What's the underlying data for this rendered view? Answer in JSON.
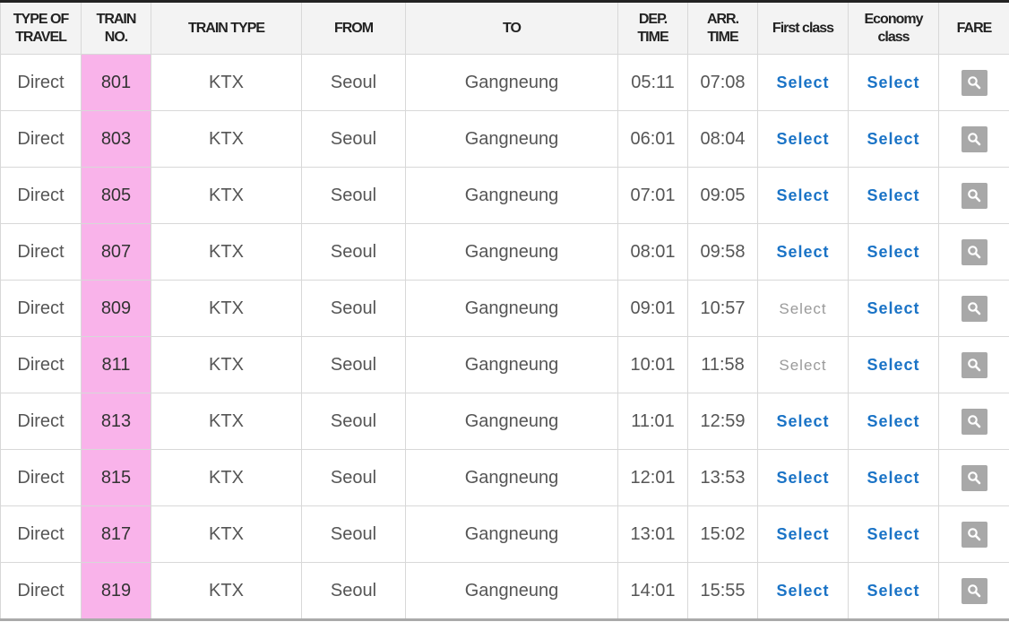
{
  "header": {
    "type_of_travel": "TYPE OF TRAVEL",
    "train_no": "TRAIN NO.",
    "train_type": "TRAIN TYPE",
    "from": "FROM",
    "to": "TO",
    "dep_time": "DEP. TIME",
    "arr_time": "ARR. TIME",
    "first_class": "First class",
    "economy_class": "Economy class",
    "fare": "FARE"
  },
  "colors": {
    "train_no_bg": "#f9b3ea",
    "select_active": "#1a73c6",
    "select_disabled": "#9a9a9a",
    "fare_button": "#a8a8a8"
  },
  "fare_icon": "magnifier-icon",
  "rows": [
    {
      "type": "Direct",
      "train_no": "801",
      "train_type": "KTX",
      "from": "Seoul",
      "to": "Gangneung",
      "dep": "05:11",
      "arr": "07:08",
      "first": "Select",
      "first_available": true,
      "economy": "Select",
      "economy_available": true
    },
    {
      "type": "Direct",
      "train_no": "803",
      "train_type": "KTX",
      "from": "Seoul",
      "to": "Gangneung",
      "dep": "06:01",
      "arr": "08:04",
      "first": "Select",
      "first_available": true,
      "economy": "Select",
      "economy_available": true
    },
    {
      "type": "Direct",
      "train_no": "805",
      "train_type": "KTX",
      "from": "Seoul",
      "to": "Gangneung",
      "dep": "07:01",
      "arr": "09:05",
      "first": "Select",
      "first_available": true,
      "economy": "Select",
      "economy_available": true
    },
    {
      "type": "Direct",
      "train_no": "807",
      "train_type": "KTX",
      "from": "Seoul",
      "to": "Gangneung",
      "dep": "08:01",
      "arr": "09:58",
      "first": "Select",
      "first_available": true,
      "economy": "Select",
      "economy_available": true
    },
    {
      "type": "Direct",
      "train_no": "809",
      "train_type": "KTX",
      "from": "Seoul",
      "to": "Gangneung",
      "dep": "09:01",
      "arr": "10:57",
      "first": "Select",
      "first_available": false,
      "economy": "Select",
      "economy_available": true
    },
    {
      "type": "Direct",
      "train_no": "811",
      "train_type": "KTX",
      "from": "Seoul",
      "to": "Gangneung",
      "dep": "10:01",
      "arr": "11:58",
      "first": "Select",
      "first_available": false,
      "economy": "Select",
      "economy_available": true
    },
    {
      "type": "Direct",
      "train_no": "813",
      "train_type": "KTX",
      "from": "Seoul",
      "to": "Gangneung",
      "dep": "11:01",
      "arr": "12:59",
      "first": "Select",
      "first_available": true,
      "economy": "Select",
      "economy_available": true
    },
    {
      "type": "Direct",
      "train_no": "815",
      "train_type": "KTX",
      "from": "Seoul",
      "to": "Gangneung",
      "dep": "12:01",
      "arr": "13:53",
      "first": "Select",
      "first_available": true,
      "economy": "Select",
      "economy_available": true
    },
    {
      "type": "Direct",
      "train_no": "817",
      "train_type": "KTX",
      "from": "Seoul",
      "to": "Gangneung",
      "dep": "13:01",
      "arr": "15:02",
      "first": "Select",
      "first_available": true,
      "economy": "Select",
      "economy_available": true
    },
    {
      "type": "Direct",
      "train_no": "819",
      "train_type": "KTX",
      "from": "Seoul",
      "to": "Gangneung",
      "dep": "14:01",
      "arr": "15:55",
      "first": "Select",
      "first_available": true,
      "economy": "Select",
      "economy_available": true
    }
  ]
}
